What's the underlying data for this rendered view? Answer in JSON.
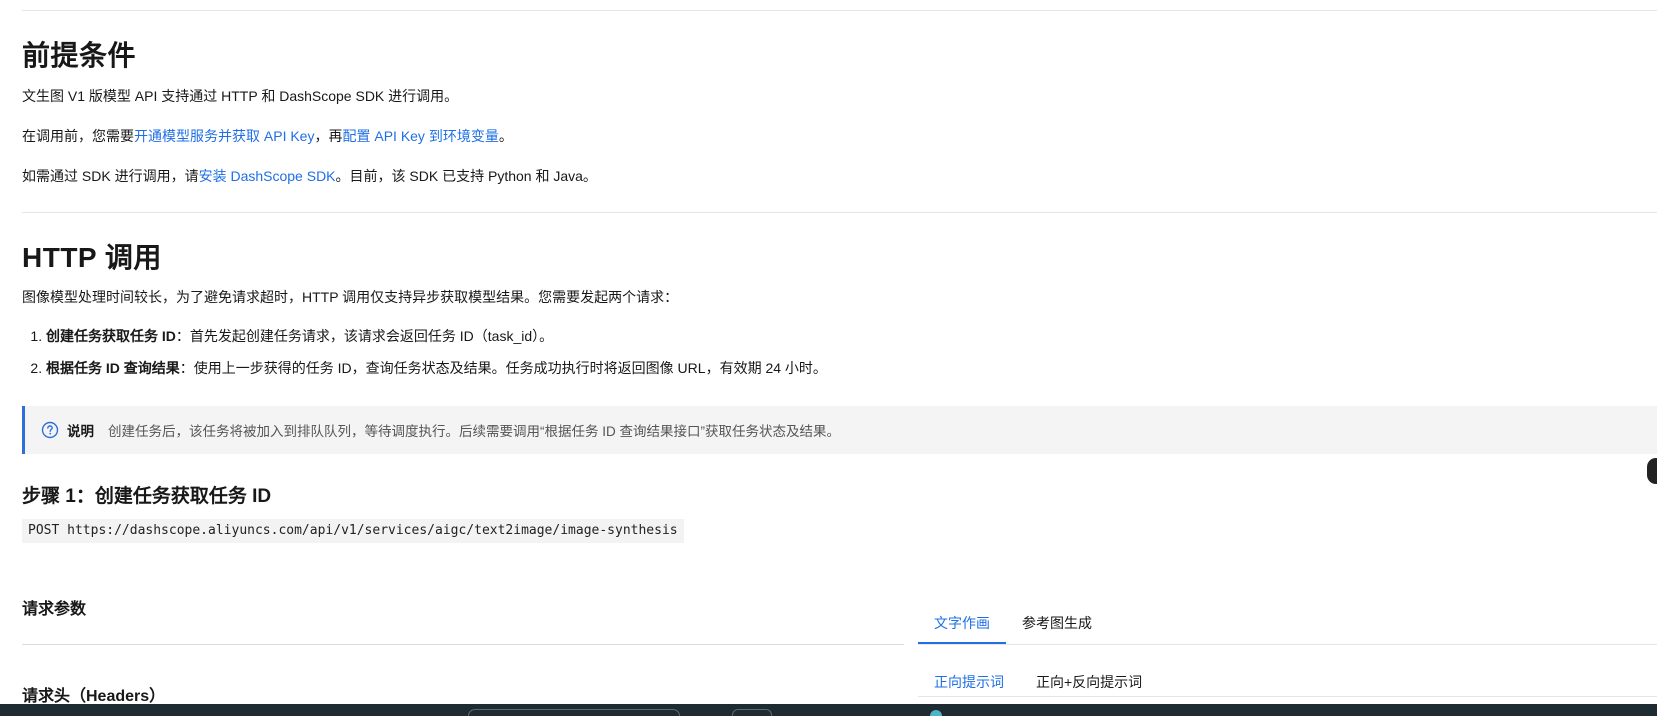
{
  "sections": {
    "prerequisites": {
      "title": "前提条件",
      "p1": "文生图 V1 版模型 API 支持通过 HTTP 和 DashScope SDK 进行调用。",
      "p2_pre": "在调用前，您需要",
      "p2_link1": "开通模型服务并获取 API Key",
      "p2_mid": "，再",
      "p2_link2": "配置 API Key 到环境变量",
      "p2_post": "。",
      "p3_pre": "如需通过 SDK 进行调用，请",
      "p3_link": "安装 DashScope SDK",
      "p3_post": "。目前，该 SDK 已支持 Python 和 Java。"
    },
    "http": {
      "title": "HTTP 调用",
      "intro": "图像模型处理时间较长，为了避免请求超时，HTTP 调用仅支持异步获取模型结果。您需要发起两个请求：",
      "steps": [
        {
          "bold": "创建任务获取任务 ID",
          "text": "：首先发起创建任务请求，该请求会返回任务 ID（task_id）。"
        },
        {
          "bold": "根据任务 ID 查询结果",
          "text": "：使用上一步获得的任务 ID，查询任务状态及结果。任务成功执行时将返回图像 URL，有效期 24 小时。"
        }
      ],
      "note": {
        "title": "说明",
        "text": "创建任务后，该任务将被加入到排队队列，等待调度执行。后续需要调用“根据任务 ID 查询结果接口”获取任务状态及结果。",
        "icon": "question-circle-icon"
      },
      "step1_title": "步骤 1：创建任务获取任务 ID",
      "endpoint": "POST https://dashscope.aliyuncs.com/api/v1/services/aigc/text2image/image-synthesis",
      "params_title": "请求参数",
      "headers_title": "请求头（Headers）"
    }
  },
  "tabs": [
    "文字作画",
    "参考图生成"
  ],
  "subtabs": [
    "正向提示词",
    "正向+反向提示词"
  ],
  "colors": {
    "link": "#1f6fe5",
    "note_border": "#2f6fdc",
    "note_bg": "#f4f4f4"
  }
}
